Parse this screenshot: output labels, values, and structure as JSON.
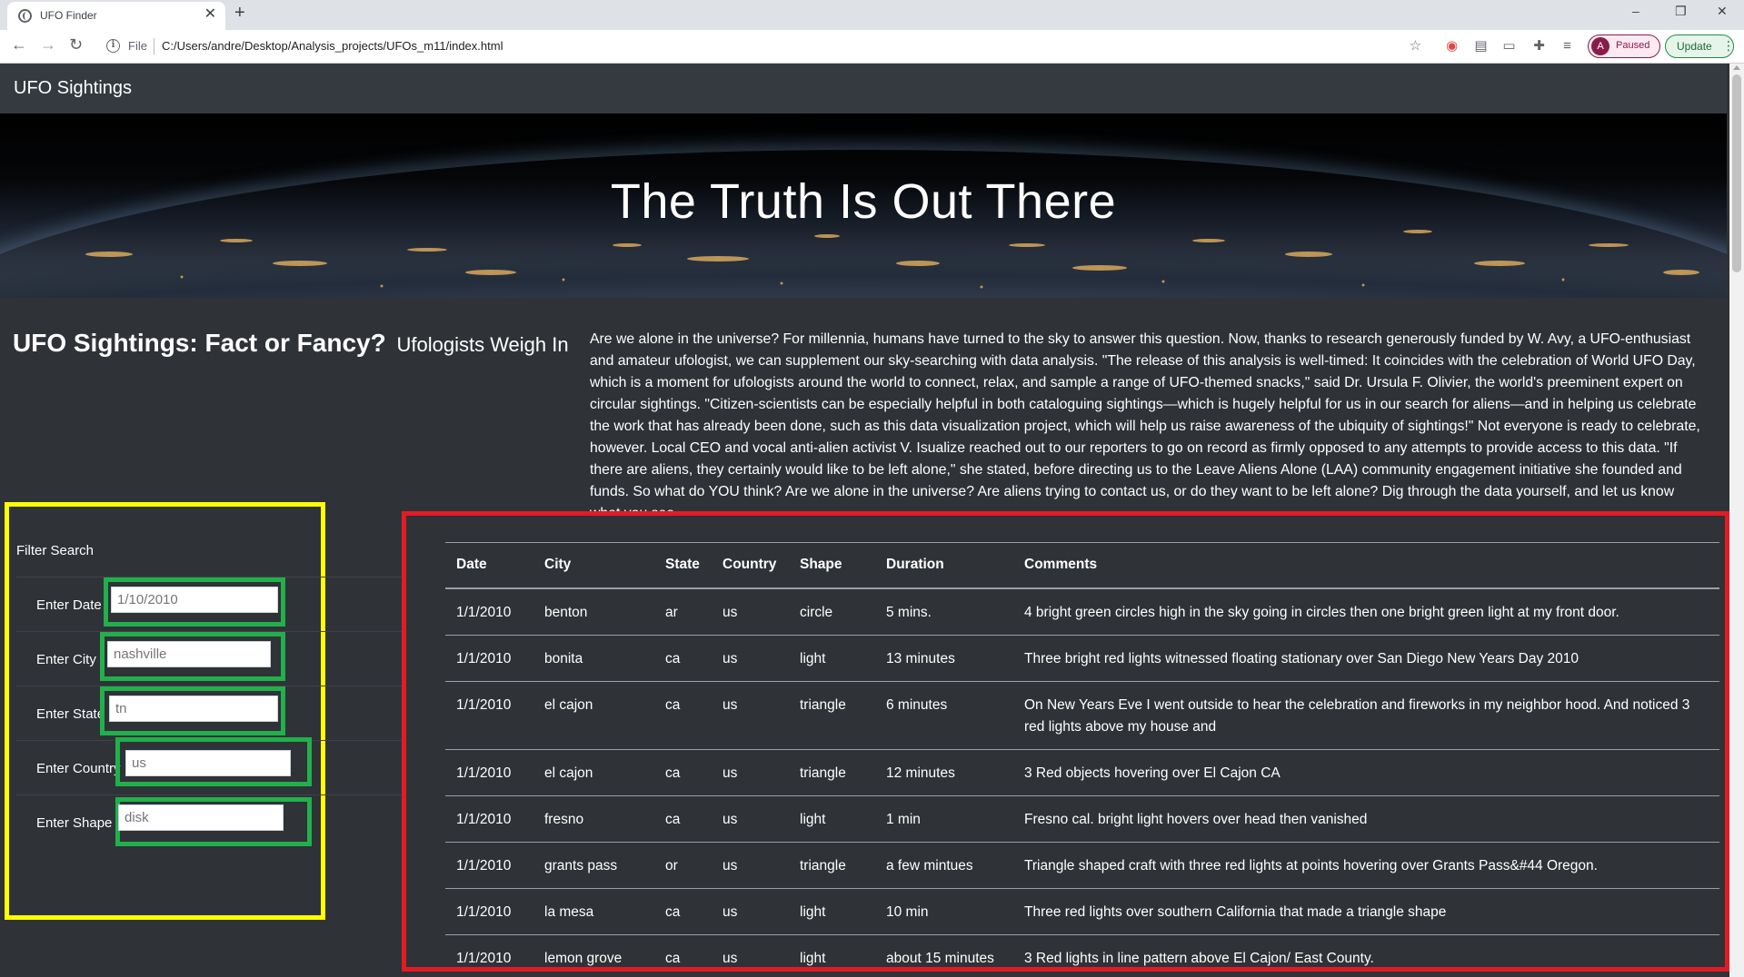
{
  "browser": {
    "tab_title": "UFO Finder",
    "tab_close": "✕",
    "new_tab": "+",
    "url_scheme": "File",
    "url": "C:/Users/andre/Desktop/Analysis_projects/UFOs_m11/index.html",
    "profile_initial": "A",
    "profile_status": "Paused",
    "update_label": "Update",
    "minimize": "–",
    "restore": "❐",
    "close": "✕"
  },
  "navbar": {
    "brand": "UFO Sightings"
  },
  "hero": {
    "title": "The Truth Is Out There"
  },
  "article": {
    "heading": "UFO Sightings: Fact or Fancy?",
    "subheading": "Ufologists Weigh In",
    "body": "Are we alone in the universe? For millennia, humans have turned to the sky to answer this question. Now, thanks to research generously funded by W. Avy, a UFO-enthusiast and amateur ufologist, we can supplement our sky-searching with data analysis. \"The release of this analysis is well-timed: It coincides with the celebration of World UFO Day, which is a moment for ufologists around the world to connect, relax, and sample a range of UFO-themed snacks,\" said Dr. Ursula F. Olivier, the world's preeminent expert on circular sightings. \"Citizen-scientists can be especially helpful in both cataloguing sightings—which is hugely helpful for us in our search for aliens—and in helping us celebrate the work that has already been done, such as this data visualization project, which will help us raise awareness of the ubiquity of sightings!\" Not everyone is ready to celebrate, however. Local CEO and vocal anti-alien activist V. Isualize reached out to our reporters to go on record as firmly opposed to any attempts to provide access to this data. \"If there are aliens, they certainly would like to be left alone,\" she stated, before directing us to the Leave Aliens Alone (LAA) community engagement initiative she founded and funds. So what do YOU think? Are we alone in the universe? Are aliens trying to contact us, or do they want to be left alone? Dig through the data yourself, and let us know what you see."
  },
  "filters": {
    "title": "Filter Search",
    "date": {
      "label": "Enter Date",
      "placeholder": "1/10/2010"
    },
    "city": {
      "label": "Enter City",
      "placeholder": "nashville"
    },
    "state": {
      "label": "Enter State",
      "placeholder": "tn"
    },
    "country": {
      "label": "Enter Country",
      "placeholder": "us"
    },
    "shape": {
      "label": "Enter Shape",
      "placeholder": "disk"
    }
  },
  "table": {
    "headers": [
      "Date",
      "City",
      "State",
      "Country",
      "Shape",
      "Duration",
      "Comments"
    ],
    "rows": [
      [
        "1/1/2010",
        "benton",
        "ar",
        "us",
        "circle",
        "5 mins.",
        "4 bright green circles high in the sky going in circles then one bright green light at my front door."
      ],
      [
        "1/1/2010",
        "bonita",
        "ca",
        "us",
        "light",
        "13 minutes",
        "Three bright red lights witnessed floating stationary over San Diego New Years Day 2010"
      ],
      [
        "1/1/2010",
        "el cajon",
        "ca",
        "us",
        "triangle",
        "6 minutes",
        "On New Years Eve I went outside to hear the celebration and fireworks in my neighbor hood. And noticed 3 red lights above my house and"
      ],
      [
        "1/1/2010",
        "el cajon",
        "ca",
        "us",
        "triangle",
        "12 minutes",
        "3 Red objects hovering over El Cajon CA"
      ],
      [
        "1/1/2010",
        "fresno",
        "ca",
        "us",
        "light",
        "1 min",
        "Fresno cal. bright light hovers over head then vanished"
      ],
      [
        "1/1/2010",
        "grants pass",
        "or",
        "us",
        "triangle",
        "a few mintues",
        "Triangle shaped craft with three red lights at points hovering over Grants Pass&#44 Oregon."
      ],
      [
        "1/1/2010",
        "la mesa",
        "ca",
        "us",
        "light",
        "10 min",
        "Three red lights over southern California that made a triangle shape"
      ],
      [
        "1/1/2010",
        "lemon grove",
        "ca",
        "us",
        "light",
        "about 15 minutes",
        "3 Red lights in line pattern above El Cajon/ East County."
      ]
    ]
  }
}
